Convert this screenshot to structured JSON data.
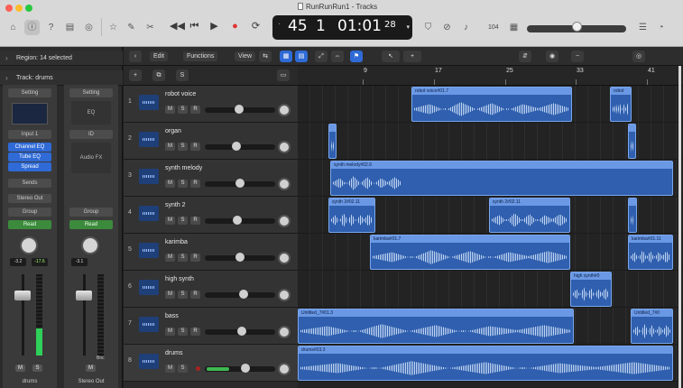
{
  "window": {
    "title": "RunRunRun1 - Tracks"
  },
  "toolbar": {
    "lcd": {
      "bar": "45",
      "beat": "1",
      "time": "01:01",
      "frames": "28"
    },
    "cpu_label": "104"
  },
  "inspector": {
    "region_label": "Region: 14 selected",
    "track_label": "Track: drums",
    "strip_a": {
      "setting": "Setting",
      "input": "Input 1",
      "plugins": [
        "Channel EQ",
        "Tube EQ",
        "Spread"
      ],
      "sends": "Sends",
      "output": "Stereo Out",
      "group": "Group",
      "mode": "Read",
      "val_left": "-3.2",
      "val_right": "-17.6",
      "name": "drums"
    },
    "strip_b": {
      "setting": "Setting",
      "eq": "EQ",
      "link": "ID",
      "fx": "Audio FX",
      "group": "Group",
      "mode": "Read",
      "val": "-3.1",
      "bnc": "Bnc",
      "name": "Stereo Out"
    }
  },
  "track_toolbar": {
    "edit": "Edit",
    "functions": "Functions",
    "view": "View"
  },
  "ruler": {
    "marks": [
      "9",
      "17",
      "25",
      "33",
      "41"
    ]
  },
  "tracks": [
    {
      "num": "1",
      "name": "robot voice"
    },
    {
      "num": "2",
      "name": "organ"
    },
    {
      "num": "3",
      "name": "synth melody"
    },
    {
      "num": "4",
      "name": "synth 2"
    },
    {
      "num": "5",
      "name": "karimba"
    },
    {
      "num": "6",
      "name": "high synth"
    },
    {
      "num": "7",
      "name": "bass"
    },
    {
      "num": "8",
      "name": "drums"
    }
  ],
  "regions": {
    "r1a": "robot voice#01.7",
    "r1b": "robot",
    "r3a": "synth melody#02.6",
    "r4a": "synth 2#02.11",
    "r4b": "synth 2#02.11",
    "r5a": "karimba#01.7",
    "r5b": "karimba#01.11",
    "r6a": "high synth#0",
    "r7a": "Untitled_7#01.3",
    "r7b": "Untitled_7#0",
    "r8a": "drums#03.3"
  },
  "msr": {
    "m": "M",
    "s": "S",
    "r": "R"
  }
}
